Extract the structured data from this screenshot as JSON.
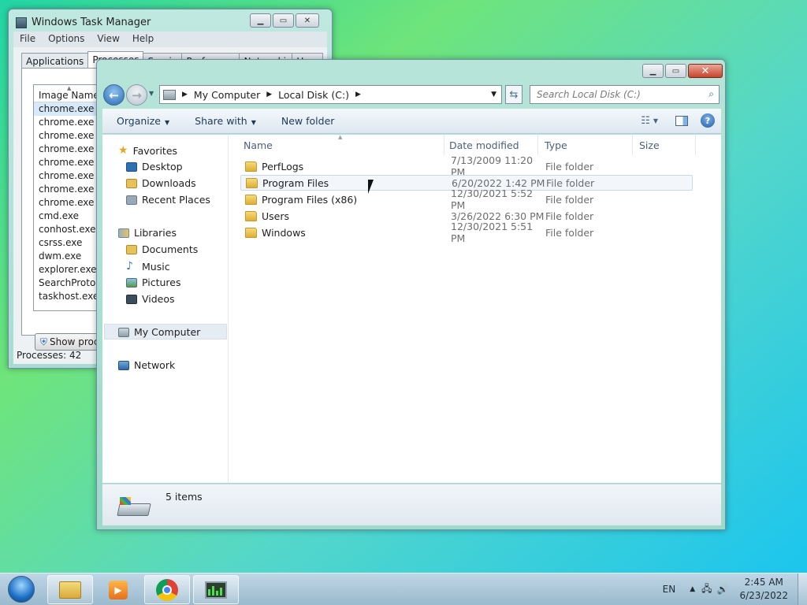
{
  "task_manager": {
    "title": "Windows Task Manager",
    "menu": [
      "File",
      "Options",
      "View",
      "Help"
    ],
    "tabs": [
      "Applications",
      "Processes",
      "Services",
      "Performance",
      "Networking",
      "Users"
    ],
    "column_header": "Image Name",
    "processes": [
      "chrome.exe",
      "chrome.exe",
      "chrome.exe",
      "chrome.exe",
      "chrome.exe",
      "chrome.exe",
      "chrome.exe",
      "chrome.exe",
      "cmd.exe",
      "conhost.exe",
      "csrss.exe",
      "dwm.exe",
      "explorer.exe",
      "SearchProtoc...",
      "taskhost.exe"
    ],
    "show_button": "Show processes from all users",
    "status": "Processes: 42"
  },
  "explorer": {
    "breadcrumb": [
      "My Computer",
      "Local Disk (C:)"
    ],
    "search_placeholder": "Search Local Disk (C:)",
    "commands": {
      "organize": "Organize",
      "share": "Share with",
      "new_folder": "New folder"
    },
    "nav": {
      "favorites": "Favorites",
      "fav_items": [
        "Desktop",
        "Downloads",
        "Recent Places"
      ],
      "libraries": "Libraries",
      "lib_items": [
        "Documents",
        "Music",
        "Pictures",
        "Videos"
      ],
      "computer": "My Computer",
      "network": "Network"
    },
    "columns": {
      "name": "Name",
      "date": "Date modified",
      "type": "Type",
      "size": "Size"
    },
    "files": [
      {
        "name": "PerfLogs",
        "date": "7/13/2009 11:20 PM",
        "type": "File folder"
      },
      {
        "name": "Program Files",
        "date": "6/20/2022 1:42 PM",
        "type": "File folder"
      },
      {
        "name": "Program Files (x86)",
        "date": "12/30/2021 5:52 PM",
        "type": "File folder"
      },
      {
        "name": "Users",
        "date": "3/26/2022 6:30 PM",
        "type": "File folder"
      },
      {
        "name": "Windows",
        "date": "12/30/2021 5:51 PM",
        "type": "File folder"
      }
    ],
    "item_count": "5 items"
  },
  "taskbar": {
    "language": "EN",
    "time": "2:45 AM",
    "date": "6/23/2022"
  }
}
